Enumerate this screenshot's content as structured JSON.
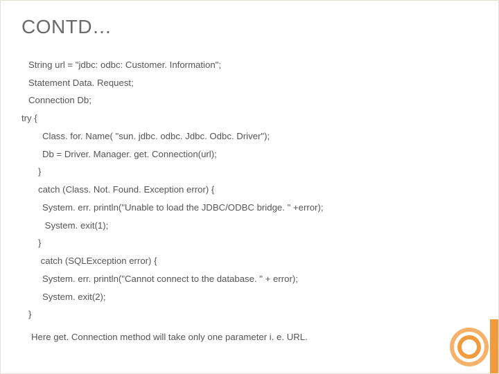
{
  "title": "CONTD…",
  "lines": [
    {
      "indent": "indent1",
      "text": "String url = \"jdbc: odbc: Customer. Information\";"
    },
    {
      "indent": "indent1",
      "text": "Statement Data. Request;"
    },
    {
      "indent": "indent1",
      "text": "Connection Db;"
    },
    {
      "indent": "indent0",
      "text": "try {"
    },
    {
      "indent": "indent2",
      "text": "Class. for. Name( \"sun. jdbc. odbc. Jdbc. Odbc. Driver\");"
    },
    {
      "indent": "indent2",
      "text": "Db = Driver. Manager. get. Connection(url);"
    },
    {
      "indent": "indent3",
      "text": "}"
    },
    {
      "indent": "indent3",
      "text": "catch (Class. Not. Found. Exception error) {"
    },
    {
      "indent": "indent4",
      "text": "System. err. println(\"Unable to load the JDBC/ODBC bridge. \" +error);"
    },
    {
      "indent": "indent4",
      "text": " System. exit(1);"
    },
    {
      "indent": "indent3",
      "text": "}"
    },
    {
      "indent": "indent3",
      "text": " catch (SQLException error) {"
    },
    {
      "indent": "indent4",
      "text": "System. err. println(\"Cannot connect to the database. \" + error);"
    },
    {
      "indent": "indent4",
      "text": "System. exit(2);"
    },
    {
      "indent": "indent1",
      "text": "}"
    }
  ],
  "footer": "Here get. Connection method will take only one parameter i. e. URL.",
  "accent_color": "#f19a3e"
}
